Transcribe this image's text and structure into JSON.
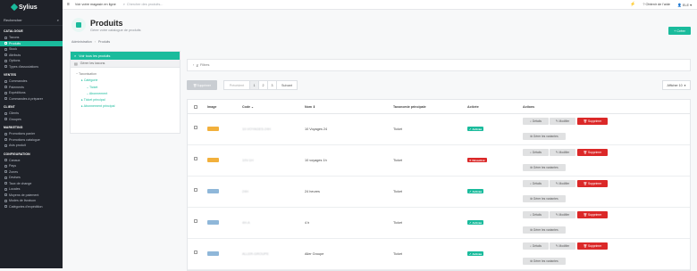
{
  "sidebar": {
    "brand": "Sylius",
    "search_label": "Rechercher",
    "sections": [
      {
        "title": "CATALOGUE",
        "items": [
          "Taxons",
          "Produits",
          "Stock",
          "Attributs",
          "Options",
          "Types d'associations"
        ]
      },
      {
        "title": "VENTES",
        "items": [
          "Commandes",
          "Paiements",
          "Expéditions",
          "Commandes à préparer"
        ]
      },
      {
        "title": "CLIENT",
        "items": [
          "Clients",
          "Groupes"
        ]
      },
      {
        "title": "MARKETING",
        "items": [
          "Promotions panier",
          "Promotions catalogue",
          "Avis produit"
        ]
      },
      {
        "title": "CONFIGURATION",
        "items": [
          "Canaux",
          "Pays",
          "Zones",
          "Devises",
          "Taux de change",
          "Locales",
          "Moyens de paiement",
          "Modes de livraison",
          "Catégories d'expédition"
        ]
      }
    ],
    "active_item": "Produits"
  },
  "topbar": {
    "shop_link": "Voir votre magasin en ligne",
    "search_placeholder": "Chercher des produits...",
    "help": "Obtenir de l'aide",
    "user": "ELE"
  },
  "header": {
    "title": "Produits",
    "subtitle": "Gérer votre catalogue de produits",
    "create_label": "+ Créer"
  },
  "breadcrumb": [
    "Administration",
    "Produits"
  ],
  "tree_panel": {
    "all_products": "Voir tous les produits",
    "manage_taxons": "Gérer les taxons",
    "tree": [
      {
        "label": "Taxonisation",
        "level": 0,
        "muted": true
      },
      {
        "label": "Catégorie",
        "level": 1
      },
      {
        "label": "Ticket",
        "level": 2
      },
      {
        "label": "Abonnement",
        "level": 2
      },
      {
        "label": "Ticket principal",
        "level": 1
      },
      {
        "label": "Abonnement principal",
        "level": 1
      }
    ]
  },
  "filters_label": "Filtres",
  "bulk_delete": "Supprimer",
  "pagination": {
    "prev": "Précédent",
    "pages": [
      "1",
      "2",
      "3"
    ],
    "next": "Suivant",
    "current": "1"
  },
  "show_label": "Afficher 10",
  "table": {
    "columns": {
      "image": "Image",
      "code": "Code",
      "name": "Nom ⇕",
      "taxon": "Taxonomie principale",
      "enabled": "Activée",
      "actions": "Actions"
    },
    "rows": [
      {
        "code": "10-VOYAGES-24H",
        "name": "10 Voyages 24",
        "taxon": "Ticket",
        "enabled": true,
        "status": "Activée",
        "thumb": "#f2b03c"
      },
      {
        "code": "10V-1H",
        "name": "10 voyages 1h",
        "taxon": "Ticket",
        "enabled": false,
        "status": "Désactivé",
        "thumb": "#f2b03c"
      },
      {
        "code": "24H",
        "name": "24 heures",
        "taxon": "Ticket",
        "enabled": true,
        "status": "Activée",
        "thumb": "#8fb7d9"
      },
      {
        "code": "4H-A",
        "name": "4 h",
        "taxon": "Ticket",
        "enabled": true,
        "status": "Activée",
        "thumb": "#8fb7d9"
      },
      {
        "code": "ALLER-GROUPE",
        "name": "Aller Groupe",
        "taxon": "Ticket",
        "enabled": true,
        "status": "Activée",
        "thumb": "#8fb7d9"
      }
    ],
    "actions": {
      "details": "Détails",
      "edit": "Modifier",
      "delete": "Supprimer",
      "variants": "Gérer les variantes"
    }
  },
  "colors": {
    "accent": "#1abb9c",
    "danger": "#db2828",
    "sidebar": "#1f2229"
  }
}
